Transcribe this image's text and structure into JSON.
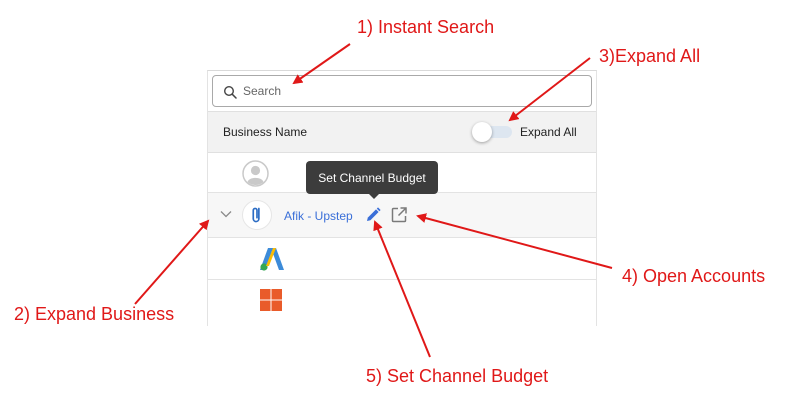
{
  "search": {
    "placeholder": "Search"
  },
  "header": {
    "column_label": "Business Name",
    "expand_all_label": "Expand All"
  },
  "business": {
    "name": "Afik - Upstep"
  },
  "tooltip": {
    "text": "Set Channel Budget"
  },
  "icons": {
    "search": "search-icon",
    "toggle": "expand-all-toggle",
    "avatar": "user-avatar-icon",
    "expand": "chevron-down-icon",
    "business_logo": "paperclip-logo-icon",
    "edit": "pencil-icon",
    "open": "external-link-icon",
    "adwords": "google-ads-icon",
    "windows": "windows-icon"
  },
  "annotations": {
    "instant_search": "1) Instant Search",
    "expand_business": "2) Expand Business",
    "expand_all": "3)Expand All",
    "open_accounts": "4) Open Accounts",
    "set_channel_budget": "5) Set Channel Budget"
  },
  "colors": {
    "annotation": "#e01818",
    "link": "#3a6fd8",
    "tooltip_bg": "#3c3c3c",
    "header_bg": "#f2f2f2"
  }
}
